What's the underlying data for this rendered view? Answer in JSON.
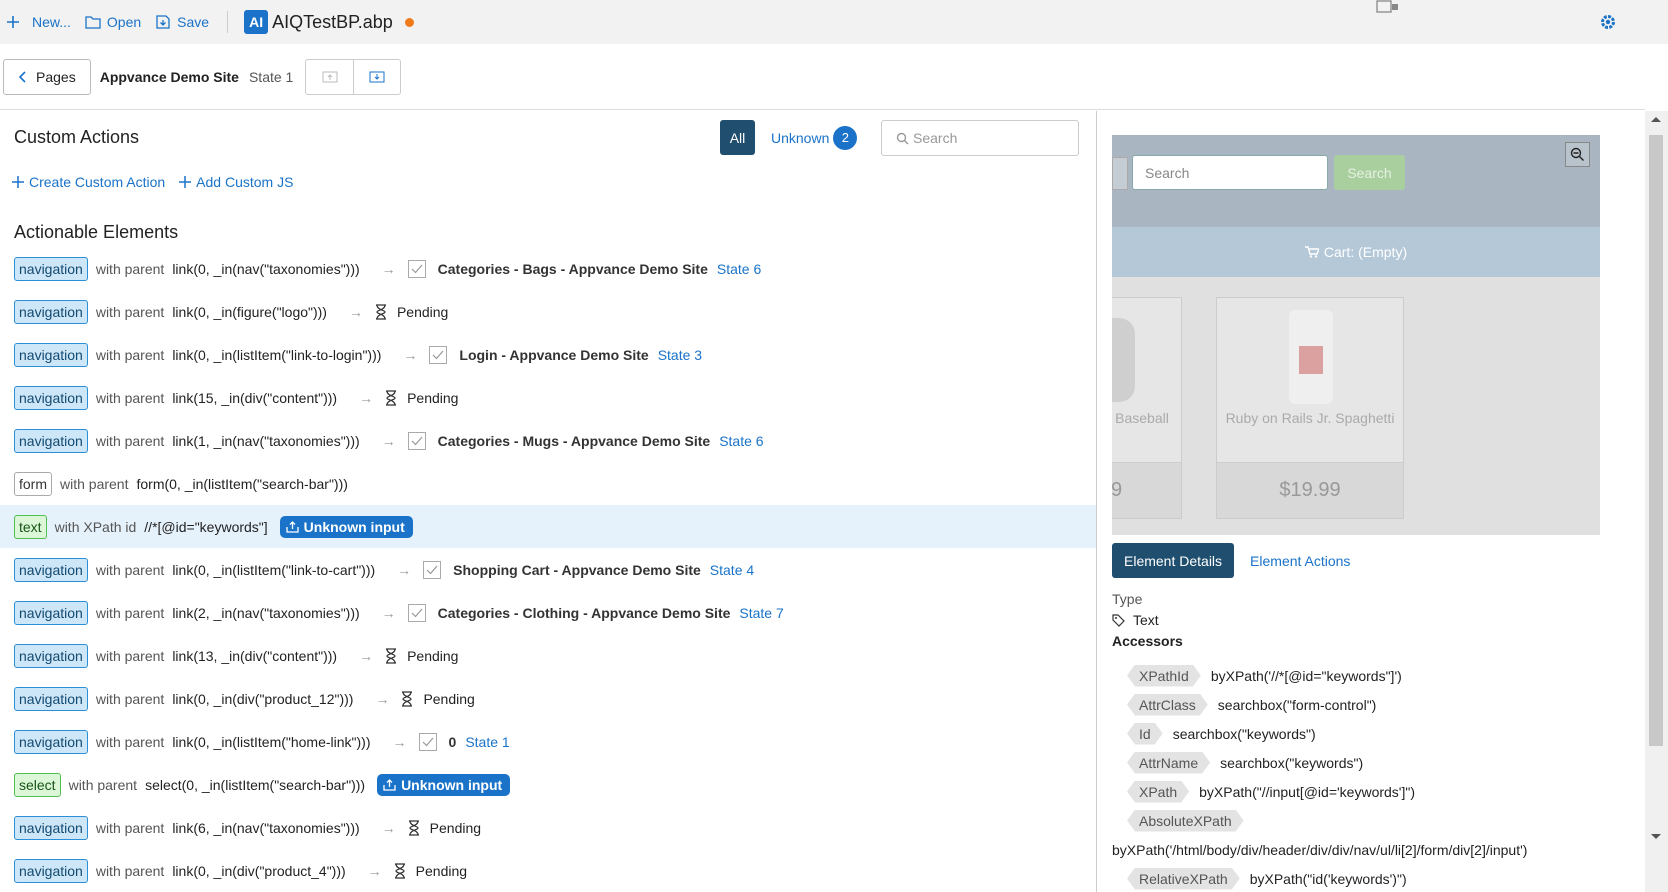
{
  "toolbar": {
    "new_label": "New...",
    "open_label": "Open",
    "save_label": "Save",
    "file_logo": "AI",
    "file_name": "AIQTestBP.abp",
    "unsaved_color": "#f07a1a"
  },
  "pagebar": {
    "pages_label": "Pages",
    "site_name": "Appvance Demo Site",
    "state": "State 1"
  },
  "custom": {
    "title": "Custom Actions",
    "filter_all": "All",
    "filter_unknown": "Unknown",
    "unknown_count": "2",
    "search_placeholder": "Search",
    "create_label": "Create Custom Action",
    "add_js_label": "Add Custom JS"
  },
  "actionable": {
    "title": "Actionable Elements",
    "rows": [
      {
        "tag": "navigation",
        "kind": "nav",
        "prefix": "with parent",
        "code": "link(0, _in(nav(\"taxonomies\")))",
        "result": "state",
        "target": "Categories - Bags - Appvance Demo Site",
        "state": "State 6"
      },
      {
        "tag": "navigation",
        "kind": "nav",
        "prefix": "with parent",
        "code": "link(0, _in(figure(\"logo\")))",
        "result": "pending",
        "pending": "Pending"
      },
      {
        "tag": "navigation",
        "kind": "nav",
        "prefix": "with parent",
        "code": "link(0, _in(listItem(\"link-to-login\")))",
        "result": "state",
        "target": "Login - Appvance Demo Site",
        "state": "State 3"
      },
      {
        "tag": "navigation",
        "kind": "nav",
        "prefix": "with parent",
        "code": "link(15, _in(div(\"content\")))",
        "result": "pending",
        "pending": "Pending"
      },
      {
        "tag": "navigation",
        "kind": "nav",
        "prefix": "with parent",
        "code": "link(1, _in(nav(\"taxonomies\")))",
        "result": "state",
        "target": "Categories - Mugs - Appvance Demo Site",
        "state": "State 6"
      },
      {
        "tag": "form",
        "kind": "form",
        "prefix": "with parent",
        "code": "form(0, _in(listItem(\"search-bar\")))",
        "result": "none"
      },
      {
        "tag": "text",
        "kind": "text",
        "prefix": "with XPath id",
        "code": "//*[@id=\"keywords\"]",
        "result": "unknown",
        "unknown": "Unknown input",
        "selected": true
      },
      {
        "tag": "navigation",
        "kind": "nav",
        "prefix": "with parent",
        "code": "link(0, _in(listItem(\"link-to-cart\")))",
        "result": "state",
        "target": "Shopping Cart - Appvance Demo Site",
        "state": "State 4"
      },
      {
        "tag": "navigation",
        "kind": "nav",
        "prefix": "with parent",
        "code": "link(2, _in(nav(\"taxonomies\")))",
        "result": "state",
        "target": "Categories - Clothing - Appvance Demo Site",
        "state": "State 7"
      },
      {
        "tag": "navigation",
        "kind": "nav",
        "prefix": "with parent",
        "code": "link(13, _in(div(\"content\")))",
        "result": "pending",
        "pending": "Pending"
      },
      {
        "tag": "navigation",
        "kind": "nav",
        "prefix": "with parent",
        "code": "link(0, _in(div(\"product_12\")))",
        "result": "pending",
        "pending": "Pending"
      },
      {
        "tag": "navigation",
        "kind": "nav",
        "prefix": "with parent",
        "code": "link(0, _in(listItem(\"home-link\")))",
        "result": "state",
        "target": "0",
        "state": "State 1"
      },
      {
        "tag": "select",
        "kind": "select",
        "prefix": "with parent",
        "code": "select(0, _in(listItem(\"search-bar\")))",
        "result": "unknown",
        "unknown": "Unknown input"
      },
      {
        "tag": "navigation",
        "kind": "nav",
        "prefix": "with parent",
        "code": "link(6, _in(nav(\"taxonomies\")))",
        "result": "pending",
        "pending": "Pending"
      },
      {
        "tag": "navigation",
        "kind": "nav",
        "prefix": "with parent",
        "code": "link(0, _in(div(\"product_4\")))",
        "result": "pending",
        "pending": "Pending"
      }
    ]
  },
  "preview": {
    "search_placeholder": "Search",
    "search_button": "Search",
    "cart_label": "Cart: (Empty)",
    "product1_name": "Baseball",
    "product1_price": "9",
    "product2_name": "Ruby on Rails Jr. Spaghetti",
    "product2_price": "$19.99"
  },
  "details": {
    "tab_details": "Element Details",
    "tab_actions": "Element Actions",
    "type_label": "Type",
    "type_value": "Text",
    "accessors_label": "Accessors",
    "accessors": [
      {
        "name": "XPathId",
        "value": "byXPath('//*[@id=\"keywords\"]')"
      },
      {
        "name": "AttrClass",
        "value": "searchbox(\"form-control\")"
      },
      {
        "name": "Id",
        "value": "searchbox(\"keywords\")"
      },
      {
        "name": "AttrName",
        "value": "searchbox(\"keywords\")"
      },
      {
        "name": "XPath",
        "value": "byXPath(\"//input[@id='keywords']\")"
      },
      {
        "name": "AbsoluteXPath",
        "value": "byXPath('/html/body/div/header/div/div/nav/ul/li[2]/form/div[2]/input')",
        "wrap": true
      },
      {
        "name": "RelativeXPath",
        "value": "byXPath(\"id('keywords')\")"
      }
    ]
  }
}
